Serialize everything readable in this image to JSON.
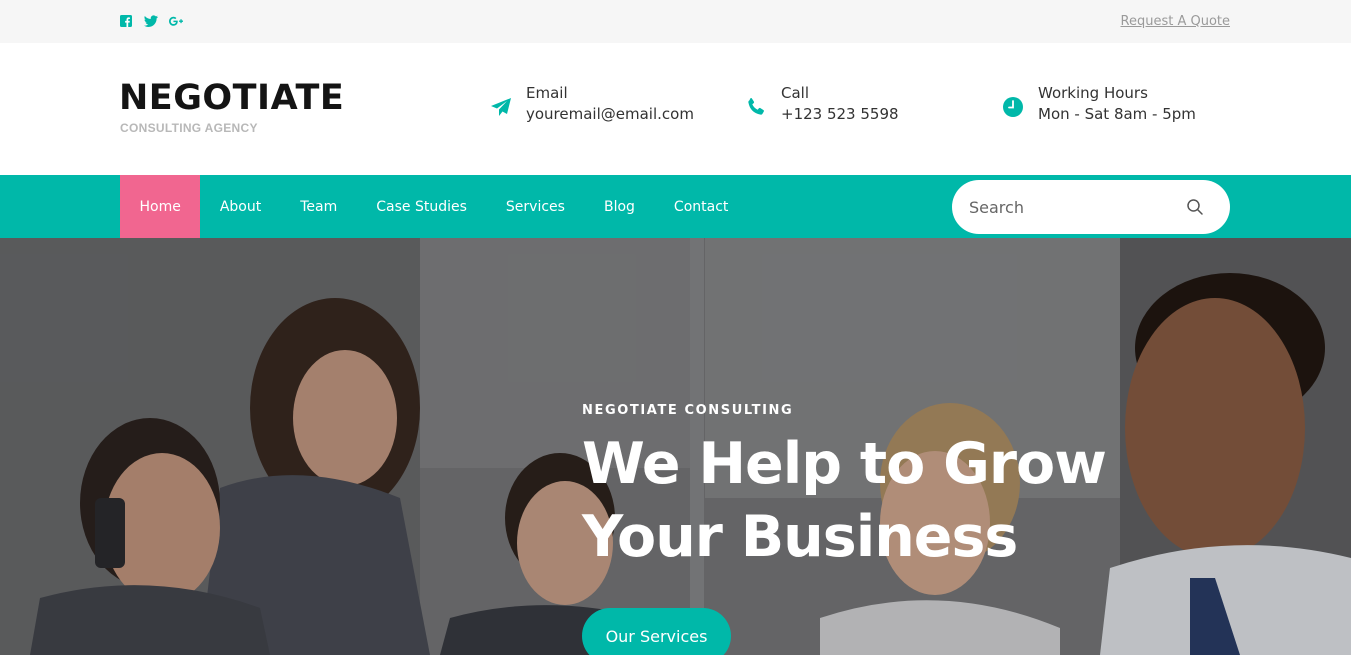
{
  "topbar": {
    "social": [
      {
        "icon": "facebook-icon"
      },
      {
        "icon": "twitter-icon"
      },
      {
        "icon": "google-plus-icon"
      }
    ],
    "quote_link": "Request A Quote"
  },
  "header": {
    "logo_title": "NEGOTIATE",
    "logo_subtitle": "CONSULTING AGENCY",
    "email": {
      "label": "Email",
      "value": "youremail@email.com",
      "icon": "paper-plane-icon"
    },
    "call": {
      "label": "Call",
      "value": "+123 523 5598",
      "icon": "phone-icon"
    },
    "hours": {
      "label": "Working Hours",
      "value": "Mon - Sat 8am - 5pm",
      "icon": "clock-icon"
    }
  },
  "nav": {
    "items": [
      {
        "label": "Home",
        "active": true
      },
      {
        "label": "About"
      },
      {
        "label": "Team"
      },
      {
        "label": "Case Studies"
      },
      {
        "label": "Services"
      },
      {
        "label": "Blog"
      },
      {
        "label": "Contact"
      }
    ],
    "search": {
      "placeholder": "Search",
      "icon": "search-icon"
    }
  },
  "hero": {
    "kicker": "NEGOTIATE CONSULTING",
    "title": "We Help to Grow Your Business",
    "button": "Our Services"
  },
  "colors": {
    "accent": "#00b8a9",
    "active_nav": "#f16690"
  }
}
